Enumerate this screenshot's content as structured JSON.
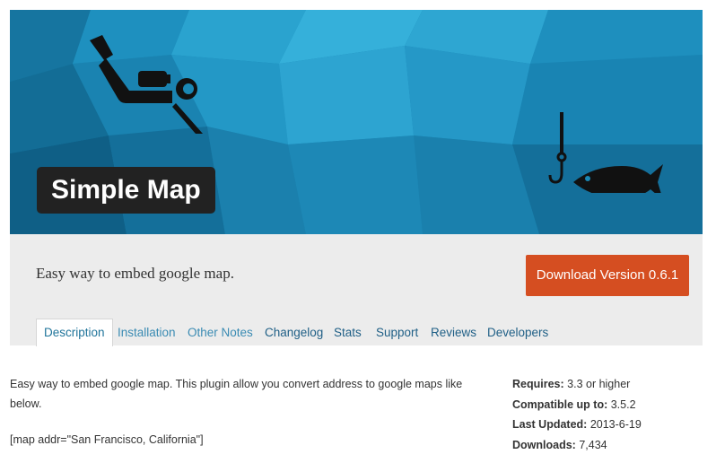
{
  "banner": {
    "title": "Simple Map",
    "background_color": "#1a87b4",
    "icons": [
      "scuba-diver-icon",
      "fish-hook-icon",
      "fish-icon"
    ]
  },
  "header": {
    "tagline": "Easy way to embed google map.",
    "download_label": "Download Version 0.6.1",
    "download_color": "#d54e21"
  },
  "tabs": [
    {
      "label": "Description",
      "active": true
    },
    {
      "label": "Installation"
    },
    {
      "label": "Other Notes"
    },
    {
      "label": "Changelog"
    },
    {
      "label": "Stats"
    },
    {
      "label": "Support"
    },
    {
      "label": "Reviews"
    },
    {
      "label": "Developers"
    }
  ],
  "content": {
    "description": "Easy way to embed google map. This plugin allow you convert address to google maps like below.",
    "shortcode": "[map addr=\"San Francisco, California\"]"
  },
  "meta": {
    "requires_label": "Requires:",
    "requires_value": "3.3 or higher",
    "compatible_label": "Compatible up to:",
    "compatible_value": "3.5.2",
    "updated_label": "Last Updated:",
    "updated_value": "2013-6-19",
    "downloads_label": "Downloads:",
    "downloads_value": "7,434"
  }
}
